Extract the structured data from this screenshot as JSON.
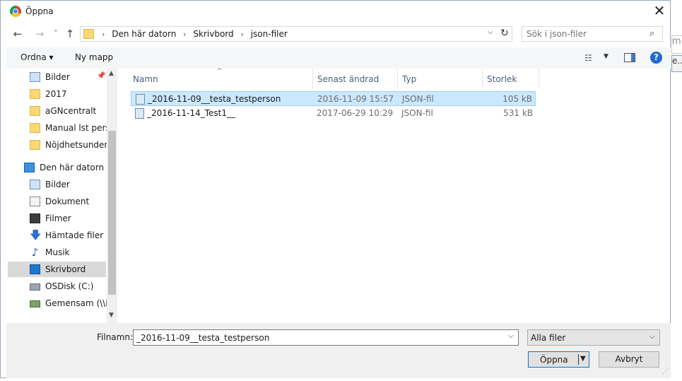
{
  "window": {
    "title": "Öppna",
    "close_glyph": "✕"
  },
  "nav_buttons": {
    "back": "←",
    "forward": "→",
    "recent": "˅",
    "up": "↑"
  },
  "address": {
    "crumbs": [
      "Den här datorn",
      "Skrivbord",
      "json-filer"
    ],
    "separator": "›",
    "dropdown_glyph": "⌵",
    "refresh_glyph": "↻"
  },
  "search": {
    "placeholder": "Sök i json-filer"
  },
  "toolbar": {
    "organize_label": "Ordna ▾",
    "new_folder_label": "Ny mapp"
  },
  "sidebar": {
    "items": [
      {
        "label": "Bilder",
        "icon": "pictures-icon",
        "pinned": true
      },
      {
        "label": "2017",
        "icon": "folder-icon"
      },
      {
        "label": "aGNcentralt",
        "icon": "folder-icon"
      },
      {
        "label": "Manual lst perso",
        "icon": "folder-icon"
      },
      {
        "label": "Nöjdhetsundersö",
        "icon": "folder-icon"
      },
      {
        "label": "Den här datorn",
        "icon": "computer-icon"
      },
      {
        "label": "Bilder",
        "icon": "pictures-icon"
      },
      {
        "label": "Dokument",
        "icon": "documents-icon"
      },
      {
        "label": "Filmer",
        "icon": "videos-icon"
      },
      {
        "label": "Hämtade filer",
        "icon": "downloads-icon"
      },
      {
        "label": "Musik",
        "icon": "music-icon"
      },
      {
        "label": "Skrivbord",
        "icon": "desktop-icon",
        "selected": true
      },
      {
        "label": "OSDisk (C:)",
        "icon": "drive-icon"
      },
      {
        "label": "Gemensam (\\\\in",
        "icon": "network-drive-icon"
      }
    ]
  },
  "columns": [
    "Namn",
    "Senast ändrad",
    "Typ",
    "Storlek"
  ],
  "files": [
    {
      "name": "_2016-11-09__testa_testperson",
      "modified": "2016-11-09 15:57",
      "type": "JSON-fil",
      "size": "105 kB",
      "selected": true
    },
    {
      "name": "_2016-11-14_Test1__",
      "modified": "2017-06-29 10:29",
      "type": "JSON-fil",
      "size": "531 kB",
      "selected": false
    }
  ],
  "footer": {
    "filename_label": "Filnamn:",
    "filename_value": "_2016-11-09__testa_testperson",
    "filter_value": "Alla filer",
    "open_label": "Öppna",
    "cancel_label": "Avbryt"
  },
  "background": {
    "fragment1": "m",
    "fragment2": "e..."
  },
  "colors": {
    "selection": "#cce8ff",
    "accent": "#0078d7",
    "help": "#1b6ad1"
  }
}
